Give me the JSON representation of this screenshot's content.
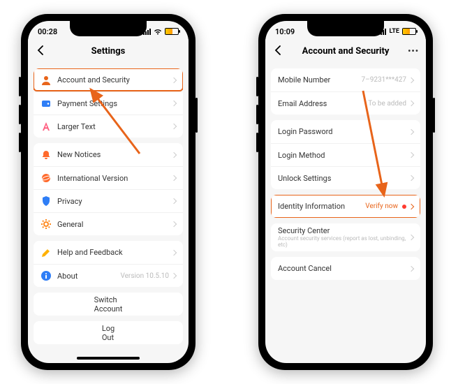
{
  "phone1": {
    "status": {
      "time": "00:28"
    },
    "nav": {
      "title": "Settings"
    },
    "groups": [
      {
        "rows": [
          {
            "icon": "user-icon",
            "color": "#e8641a",
            "label": "Account and Security"
          },
          {
            "icon": "wallet-icon",
            "color": "#2f7ef6",
            "label": "Payment Settings"
          },
          {
            "icon": "text-icon",
            "color": "#ff5b7e",
            "label": "Larger Text"
          }
        ]
      },
      {
        "rows": [
          {
            "icon": "bell-icon",
            "color": "#ff6a2c",
            "label": "New Notices"
          },
          {
            "icon": "globe-icon",
            "color": "#ff6a2c",
            "label": "International Version"
          },
          {
            "icon": "shield-icon",
            "color": "#2f7ef6",
            "label": "Privacy"
          },
          {
            "icon": "gear-icon",
            "color": "#ff8a1f",
            "label": "General"
          }
        ]
      },
      {
        "rows": [
          {
            "icon": "pencil-icon",
            "color": "#ffb100",
            "label": "Help and Feedback"
          },
          {
            "icon": "info-icon",
            "color": "#2f7ef6",
            "label": "About",
            "value": "Version 10.5.10"
          }
        ]
      },
      {
        "rows": [
          {
            "center": true,
            "label": "Switch Account"
          }
        ]
      },
      {
        "rows": [
          {
            "center": true,
            "label": "Log Out"
          }
        ]
      }
    ],
    "highlight": {
      "row": "Account and Security"
    }
  },
  "phone2": {
    "status": {
      "time": "10:09",
      "lte": "LTE"
    },
    "nav": {
      "title": "Account and Security"
    },
    "groups": [
      {
        "rows": [
          {
            "label": "Mobile Number",
            "value": "7–9231***427"
          },
          {
            "label": "Email Address",
            "value": "To be added"
          }
        ]
      },
      {
        "rows": [
          {
            "label": "Login Password"
          },
          {
            "label": "Login Method"
          },
          {
            "label": "Unlock Settings"
          }
        ]
      },
      {
        "rows": [
          {
            "label": "Identity Information",
            "value": "Verify now",
            "verify": true
          }
        ]
      },
      {
        "rows": [
          {
            "label": "Security Center",
            "sub": "Account security services (report as lost, unbinding, etc)"
          }
        ]
      },
      {
        "rows": [
          {
            "label": "Account Cancel"
          }
        ]
      }
    ],
    "highlight": {
      "row": "Identity Information"
    }
  }
}
